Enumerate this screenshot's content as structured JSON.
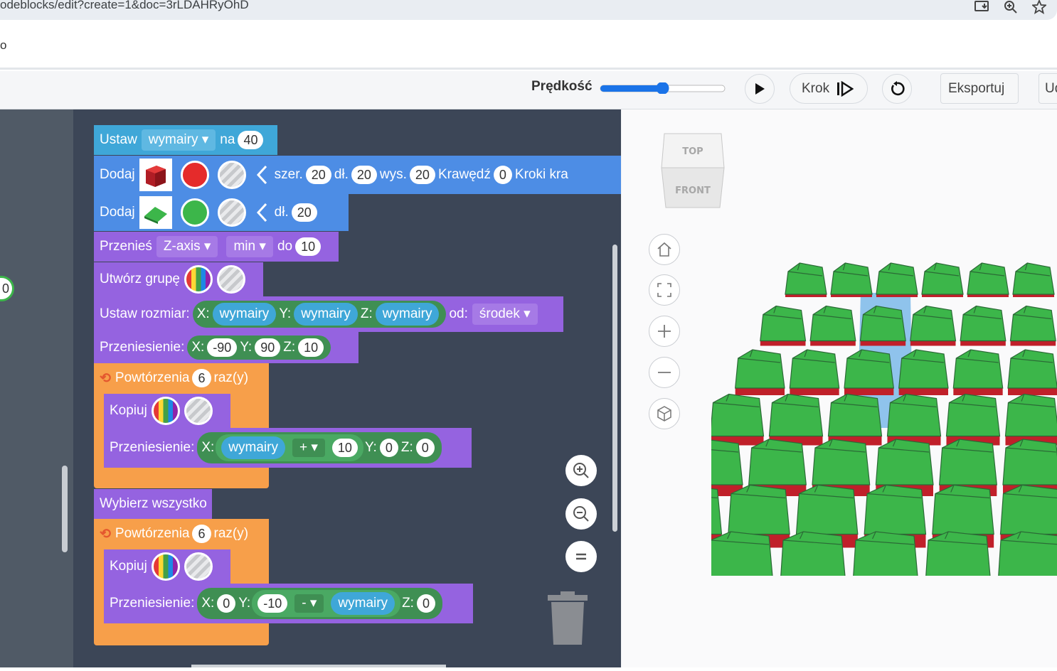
{
  "browser": {
    "url": "odeblocks/edit?create=1&doc=3rLDAHRyOhD",
    "bookmark_partial": "o"
  },
  "toolbar": {
    "speed_label": "Prędkość",
    "speed_level": 0.5,
    "step_label": "Krok",
    "export_label": "Eksportuj",
    "cut_label": "Ud"
  },
  "side": {
    "bubble_value": "0"
  },
  "blocks": {
    "set_var": {
      "label": "Ustaw",
      "var": "wymairy",
      "to": "na",
      "value": "40"
    },
    "add_box": {
      "label": "Dodaj",
      "color": "#e52b2b",
      "w_label": "szer.",
      "w": "20",
      "l_label": "dł.",
      "l": "20",
      "h_label": "wys.",
      "h": "20",
      "edge_label": "Krawędź",
      "edge": "0",
      "steps_label": "Kroki kra"
    },
    "add_roof": {
      "label": "Dodaj",
      "color": "#3cb64a",
      "l_label": "dł.",
      "l": "20"
    },
    "move": {
      "label": "Przenieś",
      "axis": "Z-axis",
      "mode": "min",
      "to": "do",
      "value": "10"
    },
    "group": {
      "label": "Utwórz grupę"
    },
    "resize": {
      "label": "Ustaw rozmiar:",
      "x_label": "X:",
      "x": "wymairy",
      "y_label": "Y:",
      "y": "wymairy",
      "z_label": "Z:",
      "z": "wymairy",
      "from_label": "od:",
      "from": "środek"
    },
    "translate": {
      "label": "Przeniesienie:",
      "x_label": "X:",
      "x": "-90",
      "y_label": "Y:",
      "y": "90",
      "z_label": "Z:",
      "z": "10"
    },
    "repeat1": {
      "label": "Powtórzenia",
      "times": "6",
      "suffix": "raz(y)"
    },
    "copy1": {
      "label": "Kopiuj"
    },
    "translate1": {
      "label": "Przeniesienie:",
      "x_label": "X:",
      "x_var": "wymairy",
      "op": "+",
      "x_num": "10",
      "y_label": "Y:",
      "y": "0",
      "z_label": "Z:",
      "z": "0"
    },
    "select_all": {
      "label": "Wybierz wszystko"
    },
    "repeat2": {
      "label": "Powtórzenia",
      "times": "6",
      "suffix": "raz(y)"
    },
    "copy2": {
      "label": "Kopiuj"
    },
    "translate2": {
      "label": "Przeniesienie:",
      "x_label": "X:",
      "x": "0",
      "y_label": "Y:",
      "y_num": "-10",
      "op": "-",
      "y_var": "wymairy",
      "z_label": "Z:",
      "z": "0"
    }
  },
  "viewcube": {
    "top": "TOP",
    "front": "FRONT"
  },
  "colors": {
    "roof_green": "#3cb64a",
    "base_red": "#c0202a",
    "accent_blue": "#1a73e8"
  }
}
